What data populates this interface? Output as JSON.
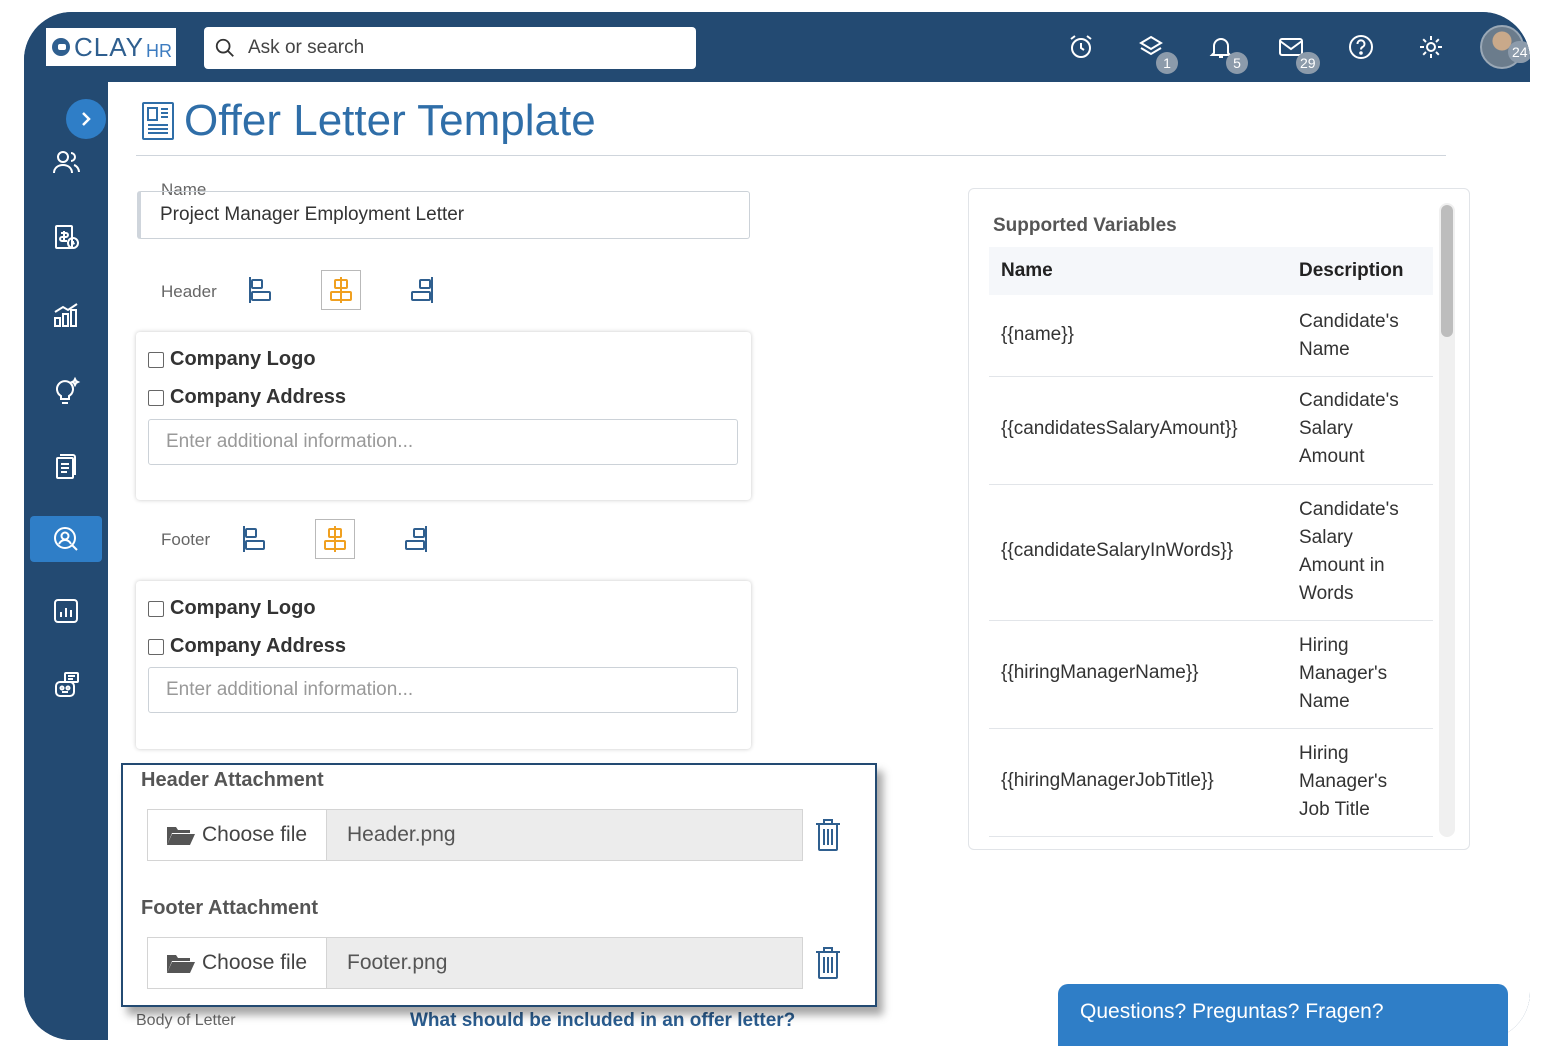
{
  "app": {
    "logo_text": "CLAY",
    "logo_suffix": "HR"
  },
  "search": {
    "placeholder": "Ask or search"
  },
  "topbar": {
    "icons": [
      "alarm-clock-icon",
      "layers-icon",
      "bell-icon",
      "mail-icon",
      "help-icon",
      "gear-icon"
    ],
    "badges": {
      "layers": "1",
      "bell": "5",
      "mail": "29",
      "avatar": "24"
    }
  },
  "page": {
    "title": "Offer Letter Template"
  },
  "form": {
    "name_label": "Name",
    "name_value": "Project Manager Employment Letter",
    "header_label": "Header",
    "footer_label": "Footer",
    "company_logo": "Company Logo",
    "company_address": "Company Address",
    "additional_placeholder": "Enter additional information..."
  },
  "attachments": {
    "header_title": "Header Attachment",
    "footer_title": "Footer Attachment",
    "choose_label": "Choose file",
    "header_file": "Header.png",
    "footer_file": "Footer.png"
  },
  "body": {
    "label": "Body of Letter",
    "link": "What should be included in an offer letter?"
  },
  "variables": {
    "title": "Supported Variables",
    "col_name": "Name",
    "col_desc": "Description",
    "rows": [
      {
        "name": "{{name}}",
        "desc": "Candidate's Name"
      },
      {
        "name": "{{candidatesSalaryAmount}}",
        "desc": "Candidate's Salary Amount"
      },
      {
        "name": "{{candidateSalaryInWords}}",
        "desc": "Candidate's Salary Amount in Words"
      },
      {
        "name": "{{hiringManagerName}}",
        "desc": "Hiring Manager's Name"
      },
      {
        "name": "{{hiringManagerJobTitle}}",
        "desc": "Hiring Manager's Job Title"
      }
    ]
  },
  "help": {
    "label": "Questions? Preguntas? Fragen?"
  },
  "colors": {
    "nav": "#234a72",
    "accent": "#2f7ec7",
    "title": "#2f6ea8",
    "active_align": "#f0a020"
  }
}
